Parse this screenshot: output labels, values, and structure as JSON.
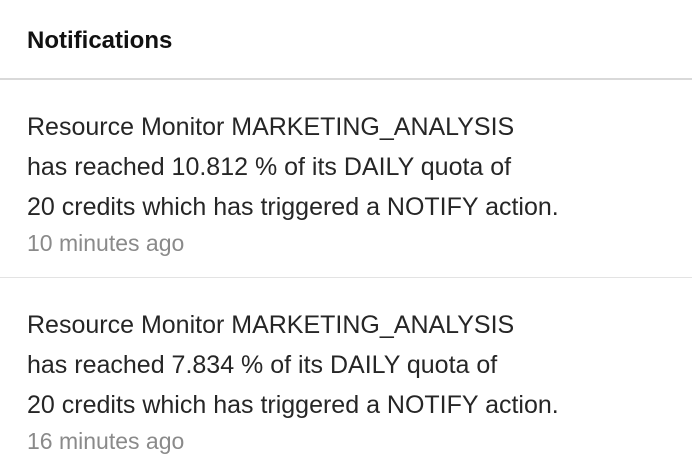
{
  "header": {
    "title": "Notifications"
  },
  "notifications": [
    {
      "lines": [
        "Resource Monitor MARKETING_ANALYSIS",
        "has reached 10.812 % of its DAILY quota of",
        "20 credits which has triggered a NOTIFY action."
      ],
      "time": "10 minutes ago"
    },
    {
      "lines": [
        "Resource Monitor MARKETING_ANALYSIS",
        "has reached 7.834 % of its DAILY quota of",
        "20 credits which has triggered a NOTIFY action."
      ],
      "time": "16 minutes ago"
    }
  ]
}
